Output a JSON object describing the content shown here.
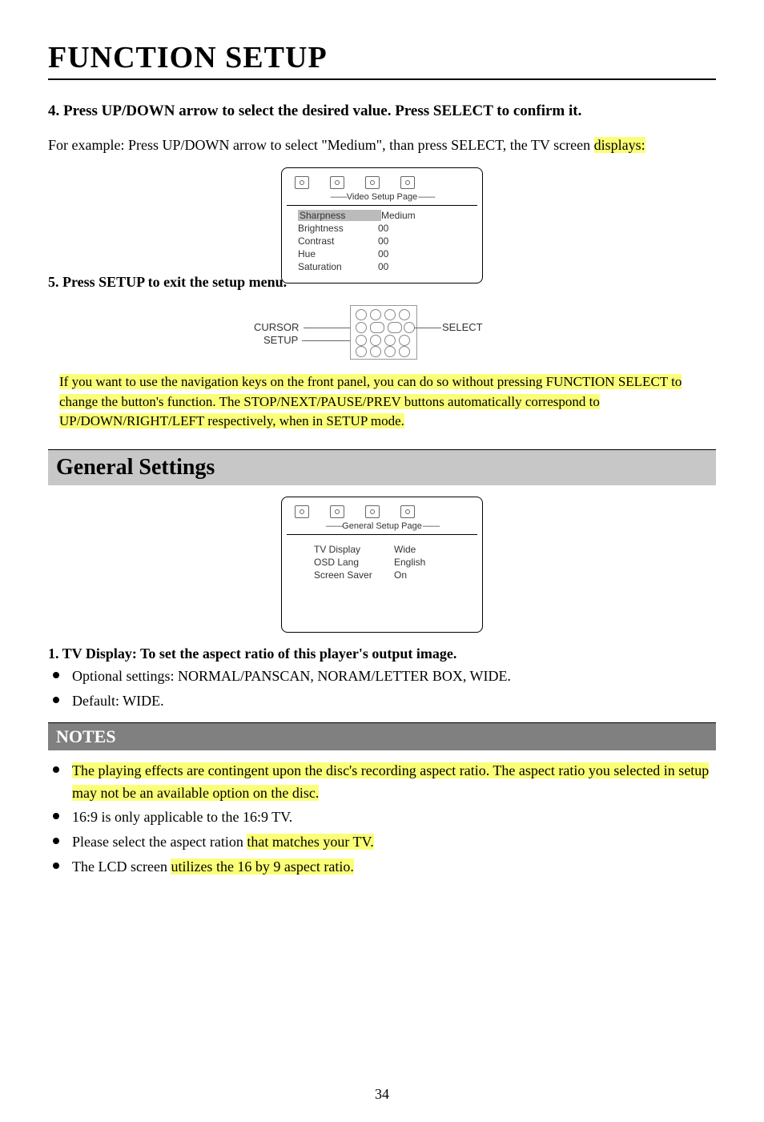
{
  "title": "FUNCTION SETUP",
  "step4": "4. Press UP/DOWN arrow to select the desired value. Press SELECT to confirm it.",
  "example_line1": "For example: Press UP/DOWN arrow to select \"Medium\", than press SELECT, the TV screen ",
  "example_line2": "displays:",
  "osd1": {
    "label": "Video Setup Page",
    "rows": [
      {
        "k": "Sharpness",
        "v": "Medium",
        "sel": true
      },
      {
        "k": "Brightness",
        "v": "00",
        "sel": false
      },
      {
        "k": "Contrast",
        "v": "00",
        "sel": false
      },
      {
        "k": "Hue",
        "v": "00",
        "sel": false
      },
      {
        "k": "Saturation",
        "v": "00",
        "sel": false
      }
    ]
  },
  "step5": "5. Press SETUP to exit the setup menu.",
  "remote": {
    "cursor": "CURSOR",
    "setup": "SETUP",
    "select": "SELECT"
  },
  "tip": "If you want to use the navigation keys on the front panel, you can do so without pressing FUNCTION SELECT to change the button's function.  The STOP/NEXT/PAUSE/PREV buttons automatically correspond to UP/DOWN/RIGHT/LEFT respectively, when in SETUP mode.",
  "general_title": "General Settings",
  "osd2": {
    "label": "General Setup Page",
    "rows": [
      {
        "k": "TV Display",
        "v": "Wide"
      },
      {
        "k": "OSD Lang",
        "v": "English"
      },
      {
        "k": "Screen Saver",
        "v": "On"
      }
    ]
  },
  "tv_display_header_bold": "1. TV Display",
  "tv_display_header_rest": ": To set the aspect ratio of this player's output image.",
  "bullet_opt": "Optional settings: NORMAL/PANSCAN, NORAM/LETTER BOX, WIDE.",
  "bullet_def": "Default: WIDE.",
  "notes_title": "NOTES",
  "notes": {
    "n1": "The playing effects are contingent upon the disc's recording aspect ratio. The aspect ratio you selected in setup may not be an available option on the disc.",
    "n2": "16:9 is only applicable to the 16:9 TV.",
    "n3a": "Please select the aspect ration ",
    "n3b": "that matches your TV.",
    "n4a": "The LCD screen ",
    "n4b": "utilizes the 16 by 9 aspect ratio."
  },
  "page_number": "34"
}
